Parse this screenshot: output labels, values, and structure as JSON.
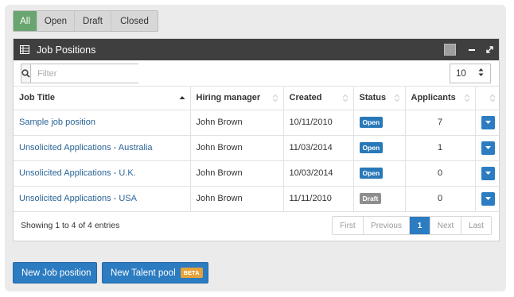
{
  "filter_tabs": [
    {
      "label": "All",
      "active": true
    },
    {
      "label": "Open",
      "active": false
    },
    {
      "label": "Draft",
      "active": false
    },
    {
      "label": "Closed",
      "active": false
    }
  ],
  "panel": {
    "title": "Job Positions",
    "title_icon": "table-icon",
    "controls": [
      "square-icon",
      "minimize-icon",
      "expand-icon"
    ]
  },
  "search": {
    "placeholder": "Filter",
    "value": ""
  },
  "page_size": {
    "value": "10"
  },
  "table": {
    "columns": [
      "Job Title",
      "Hiring manager",
      "Created",
      "Status",
      "Applicants",
      ""
    ],
    "rows": [
      {
        "title": "Sample job position",
        "manager": "John Brown",
        "created": "10/11/2010",
        "status": "Open",
        "applicants": "7"
      },
      {
        "title": "Unsolicited Applications - Australia",
        "manager": "John Brown",
        "created": "11/03/2014",
        "status": "Open",
        "applicants": "1"
      },
      {
        "title": "Unsolicited Applications - U.K.",
        "manager": "John Brown",
        "created": "10/03/2014",
        "status": "Open",
        "applicants": "0"
      },
      {
        "title": "Unsolicited Applications - USA",
        "manager": "John Brown",
        "created": "11/11/2010",
        "status": "Draft",
        "applicants": "0"
      }
    ]
  },
  "footer": {
    "info": "Showing 1 to 4 of 4 entries",
    "pagination": [
      "First",
      "Previous",
      "1",
      "Next",
      "Last"
    ],
    "current_page": "1"
  },
  "actions": {
    "new_job": "New Job position",
    "new_pool": "New Talent pool",
    "beta": "BETA"
  },
  "colors": {
    "accent_blue": "#2c7cc1",
    "active_tab_green": "#6aa470",
    "panel_header": "#3f3f3f",
    "beta_orange": "#e5a23b",
    "draft_gray": "#8e8e8e"
  }
}
